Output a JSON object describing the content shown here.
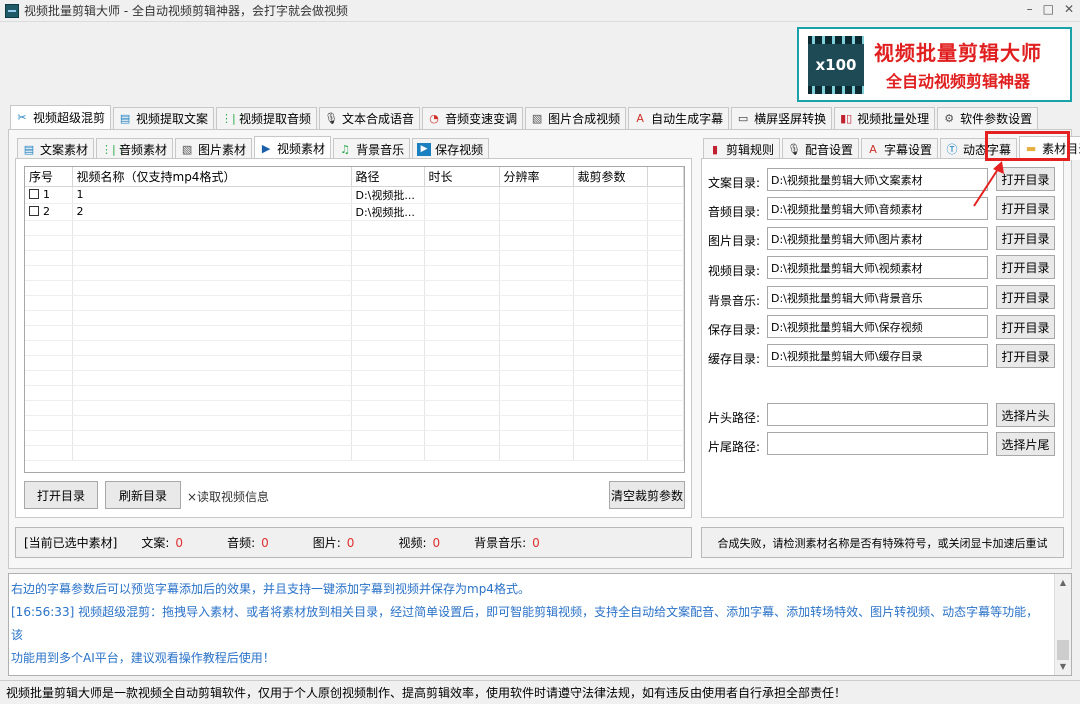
{
  "window": {
    "title": "视频批量剪辑大师 - 全自动视频剪辑神器，会打字就会做视频",
    "controls": [
      "–",
      "□",
      "✕"
    ]
  },
  "brand": {
    "logo_text": "x100",
    "line1": "视频批量剪辑大师",
    "line2": "全自动视频剪辑神器"
  },
  "top_tabs": [
    {
      "label": "视频超级混剪",
      "icon": "scissors-icon",
      "active": true
    },
    {
      "label": "视频提取文案",
      "icon": "document-icon"
    },
    {
      "label": "视频提取音频",
      "icon": "waveform-icon"
    },
    {
      "label": "文本合成语音",
      "icon": "microphone-icon"
    },
    {
      "label": "音频变速变调",
      "icon": "speedometer-icon"
    },
    {
      "label": "图片合成视频",
      "icon": "image-icon"
    },
    {
      "label": "自动生成字幕",
      "icon": "font-icon"
    },
    {
      "label": "横屏竖屏转换",
      "icon": "rotate-screen-icon"
    },
    {
      "label": "视频批量处理",
      "icon": "film-icon"
    },
    {
      "label": "软件参数设置",
      "icon": "gear-icon"
    }
  ],
  "left_tabs": [
    {
      "label": "文案素材",
      "icon": "document-icon"
    },
    {
      "label": "音频素材",
      "icon": "waveform-icon"
    },
    {
      "label": "图片素材",
      "icon": "image-icon"
    },
    {
      "label": "视频素材",
      "icon": "play-icon",
      "active": true
    },
    {
      "label": "背景音乐",
      "icon": "music-icon"
    },
    {
      "label": "保存视频",
      "icon": "play-box-icon"
    }
  ],
  "table": {
    "columns": [
      "序号",
      "视频名称（仅支持mp4格式）",
      "路径",
      "时长",
      "分辨率",
      "裁剪参数"
    ],
    "rows": [
      {
        "index": "1",
        "name": "1",
        "path": "D:\\视频批...",
        "duration": "",
        "resolution": "",
        "crop": ""
      },
      {
        "index": "2",
        "name": "2",
        "path": "D:\\视频批...",
        "duration": "",
        "resolution": "",
        "crop": ""
      }
    ]
  },
  "left_buttons": {
    "open_dir": "打开目录",
    "refresh_dir": "刷新目录",
    "read_info": "×读取视频信息",
    "clear_crop": "清空裁剪参数"
  },
  "selection_status": {
    "label": "[当前已选中素材]",
    "items": [
      {
        "label": "文案:",
        "value": "0"
      },
      {
        "label": "音频:",
        "value": "0"
      },
      {
        "label": "图片:",
        "value": "0"
      },
      {
        "label": "视频:",
        "value": "0"
      },
      {
        "label": "背景音乐:",
        "value": "0"
      }
    ]
  },
  "right_tabs": [
    {
      "label": "剪辑规则",
      "icon": "film-icon"
    },
    {
      "label": "配音设置",
      "icon": "microphone-icon"
    },
    {
      "label": "字幕设置",
      "icon": "font-icon"
    },
    {
      "label": "动态字幕",
      "icon": "text-box-icon"
    },
    {
      "label": "素材目录",
      "icon": "folder-icon",
      "active": true
    }
  ],
  "directories": [
    {
      "label": "文案目录:",
      "value": "D:\\视频批量剪辑大师\\文案素材",
      "button": "打开目录"
    },
    {
      "label": "音频目录:",
      "value": "D:\\视频批量剪辑大师\\音频素材",
      "button": "打开目录"
    },
    {
      "label": "图片目录:",
      "value": "D:\\视频批量剪辑大师\\图片素材",
      "button": "打开目录"
    },
    {
      "label": "视频目录:",
      "value": "D:\\视频批量剪辑大师\\视频素材",
      "button": "打开目录"
    },
    {
      "label": "背景音乐:",
      "value": "D:\\视频批量剪辑大师\\背景音乐",
      "button": "打开目录"
    },
    {
      "label": "保存目录:",
      "value": "D:\\视频批量剪辑大师\\保存视频",
      "button": "打开目录"
    },
    {
      "label": "缓存目录:",
      "value": "D:\\视频批量剪辑大师\\缓存目录",
      "button": "打开目录"
    }
  ],
  "clip_paths": [
    {
      "label": "片头路径:",
      "value": "",
      "button": "选择片头"
    },
    {
      "label": "片尾路径:",
      "value": "",
      "button": "选择片尾"
    }
  ],
  "right_status": "合成失败，请检测素材名称是否有特殊符号，或关闭显卡加速后重试",
  "log_lines": [
    "右边的字幕参数后可以预览字幕添加后的效果，并且支持一键添加字幕到视频并保存为mp4格式。",
    "[16:56:33] 视频超级混剪：拖拽导入素材、或者将素材放到相关目录，经过简单设置后，即可智能剪辑视频，支持全自动给文案配音、添加字幕、添加转场特效、图片转视频、动态字幕等功能，该",
    "功能用到多个AI平台，建议观看操作教程后使用！"
  ],
  "footer": "视频批量剪辑大师是一款视频全自动剪辑软件，仅用于个人原创视频制作、提高剪辑效率，使用软件时请遵守法律法规，如有违反由使用者自行承担全部责任！",
  "colors": {
    "accent_red": "#e52020",
    "log_blue": "#2a72c8",
    "brand_teal": "#19a3a8"
  }
}
